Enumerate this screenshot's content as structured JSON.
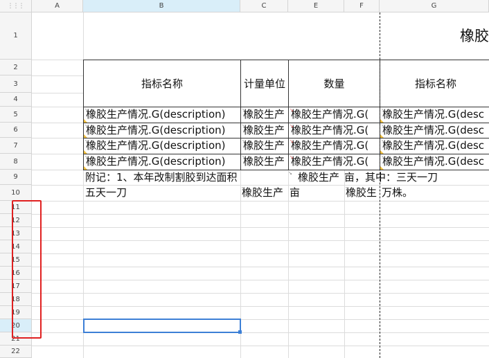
{
  "columns": [
    "A",
    "B",
    "C",
    "E",
    "F",
    "G"
  ],
  "rows": [
    "1",
    "2",
    "3",
    "4",
    "5",
    "6",
    "7",
    "8",
    "9",
    "10",
    "11",
    "12",
    "13",
    "14",
    "15",
    "16",
    "17",
    "18",
    "19",
    "20",
    "21",
    "22"
  ],
  "title_cell": "橡胶",
  "headers": {
    "indicator_name": "指标名称",
    "unit": "计量单位",
    "quantity": "数量",
    "indicator_name_2": "指标名称"
  },
  "data_rows": [
    {
      "b": "橡胶生产情况.G(description)",
      "c": "橡胶生产",
      "e": "橡胶生产情况.G(",
      "g": "橡胶生产情况.G(desc"
    },
    {
      "b": "橡胶生产情况.G(description)",
      "c": "橡胶生产",
      "e": "橡胶生产情况.G(",
      "g": "橡胶生产情况.G(desc"
    },
    {
      "b": "橡胶生产情况.G(description)",
      "c": "橡胶生产",
      "e": "橡胶生产情况.G(",
      "g": "橡胶生产情况.G(desc"
    },
    {
      "b": "橡胶生产情况.G(description)",
      "c": "橡胶生产",
      "e": "橡胶生产情况.G(",
      "g": "橡胶生产情况.G(desc"
    }
  ],
  "note_row9": {
    "b": "附记：1、本年改制割胶到达面积",
    "e": "橡胶生产",
    "f": "亩，其中：三天一刀"
  },
  "note_row10": {
    "b": "五天一刀",
    "c": "橡胶生产",
    "e": "亩",
    "f": "橡胶生",
    "g": "万株。"
  },
  "selected_row": "20",
  "selected_col": "B",
  "accent_color": "#3c7fd6",
  "highlight_color": "#e02020"
}
